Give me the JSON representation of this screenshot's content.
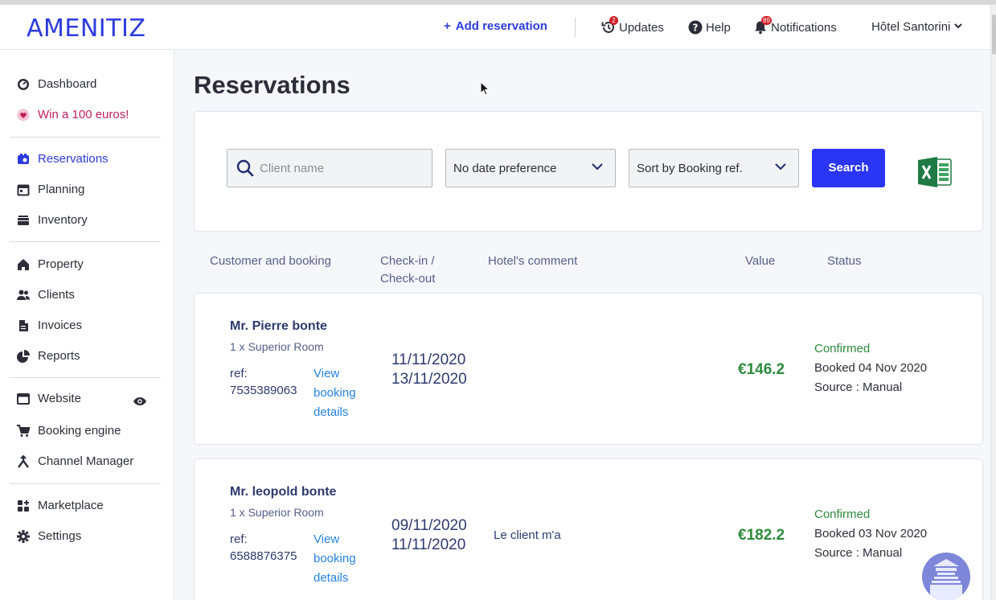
{
  "header": {
    "logo": "AMENITIZ",
    "add_reservation": "Add reservation",
    "updates": {
      "label": "Updates",
      "badge": "2"
    },
    "help": "Help",
    "notifications": {
      "label": "Notifications",
      "badge": "89"
    },
    "hotel": "Hôtel Santorini"
  },
  "sidebar": {
    "dashboard": "Dashboard",
    "promo": "Win a 100 euros!",
    "reservations": "Reservations",
    "planning": "Planning",
    "inventory": "Inventory",
    "property": "Property",
    "clients": "Clients",
    "invoices": "Invoices",
    "reports": "Reports",
    "website": "Website",
    "booking_engine": "Booking engine",
    "channel_manager": "Channel Manager",
    "marketplace": "Marketplace",
    "settings": "Settings"
  },
  "page": {
    "title": "Reservations"
  },
  "filters": {
    "search_placeholder": "Client name",
    "date_select": "No date preference",
    "sort_select": "Sort by Booking ref.",
    "search_button": "Search"
  },
  "columns": {
    "customer": "Customer and booking",
    "checkin": "Check-in /",
    "checkout": "Check-out",
    "comment": "Hotel's comment",
    "value": "Value",
    "status": "Status"
  },
  "reservations": [
    {
      "name": "Mr. Pierre bonte",
      "room": "1 x Superior Room",
      "ref_label": "ref:",
      "ref": "7535389063",
      "link_1": "View",
      "link_2": "booking",
      "link_3": "details",
      "checkin": "11/11/2020",
      "checkout": "13/11/2020",
      "comment": "",
      "value": "€146.2",
      "status": "Confirmed",
      "booked": "Booked 04 Nov 2020",
      "source": "Source : Manual"
    },
    {
      "name": "Mr. leopold bonte",
      "room": "1 x Superior Room",
      "ref_label": "ref:",
      "ref": "6588876375",
      "link_1": "View",
      "link_2": "booking",
      "link_3": "details",
      "checkin": "09/11/2020",
      "checkout": "11/11/2020",
      "comment": "Le client m'a",
      "value": "€182.2",
      "status": "Confirmed",
      "booked": "Booked 03 Nov 2020",
      "source": "Source : Manual"
    }
  ],
  "colors": {
    "brand": "#2c3bdd",
    "success": "#2e8b3e",
    "link": "#2481e2"
  }
}
